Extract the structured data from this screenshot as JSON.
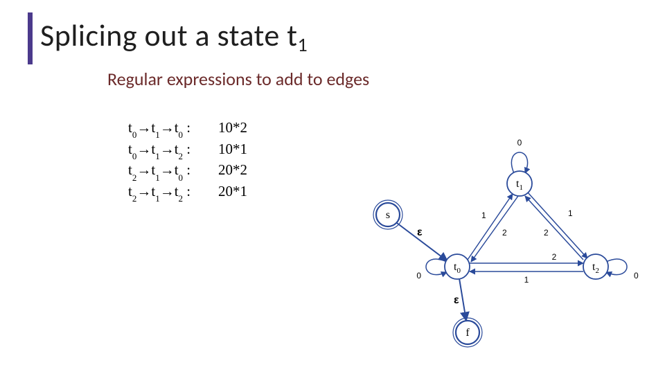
{
  "title_main": "Splicing out a state t",
  "title_sub": "1",
  "subtitle": "Regular expressions to add to edges",
  "rules": [
    {
      "path": "t0→t1→t0 :",
      "expr": "10*2"
    },
    {
      "path": "t0→t1→t2 :",
      "expr": "10*1"
    },
    {
      "path": "t2→t1→t0 :",
      "expr": "20*2"
    },
    {
      "path": "t2→t1→t2 :",
      "expr": "20*1"
    }
  ],
  "graph": {
    "nodes": {
      "s": {
        "label": "s"
      },
      "f": {
        "label": "f"
      },
      "t0": {
        "label": "t0"
      },
      "t1": {
        "label": "t1"
      },
      "t2": {
        "label": "t2"
      }
    },
    "edge_labels": {
      "s_t0": "ε",
      "t0_f": "ε",
      "t0_self": "0",
      "t1_self": "0",
      "t2_self": "0",
      "t0_t1": "1",
      "t1_t0": "2",
      "t1_t2": "1",
      "t2_t1": "2",
      "t0_t2_top": "2",
      "t2_t0_bot": "1"
    }
  }
}
